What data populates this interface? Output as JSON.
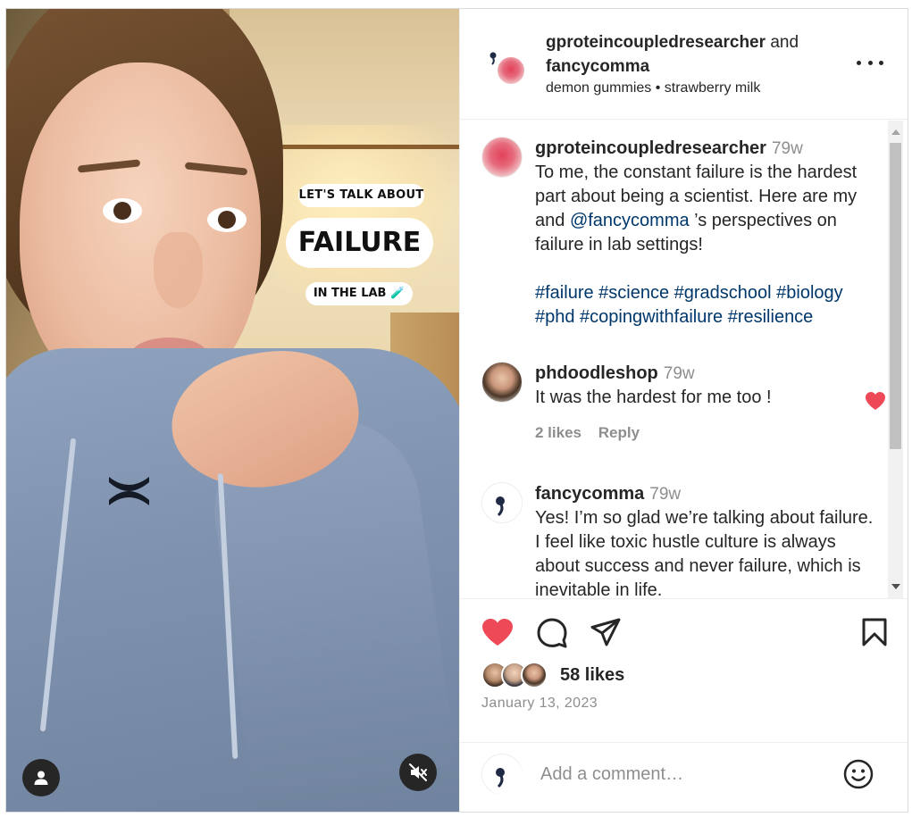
{
  "post": {
    "authors": {
      "primary": "gproteincoupledresearcher",
      "joiner": "and",
      "secondary": "fancycomma"
    },
    "audio": "demon gummies • strawberry milk",
    "overlay": {
      "line1": "LET'S TALK ABOUT",
      "line2": "FAILURE",
      "line3": "IN THE LAB 🧪"
    },
    "caption": {
      "username": "gproteincoupledresearcher",
      "time": "79w",
      "text_before": "To me, the constant failure is the hardest part about being a scientist. Here are my and ",
      "mention": "@fancycomma",
      "text_after": " ’s perspectives on failure in lab settings!",
      "hashtags": "#failure #science #gradschool #biology #phd #copingwithfailure #resilience"
    },
    "comments": [
      {
        "username": "phdoodleshop",
        "time": "79w",
        "text": "It was the hardest for me too !",
        "likes": "2 likes",
        "reply": "Reply",
        "liked": true
      },
      {
        "username": "fancycomma",
        "time": "79w",
        "text": "Yes! I’m so glad we’re talking about failure. I feel like toxic hustle culture is always about success and never failure, which is inevitable in life."
      }
    ],
    "likes_text": "58 likes",
    "date": "January 13, 2023",
    "add_comment_placeholder": "Add a comment…"
  },
  "icons": {
    "like": "heart-filled-icon",
    "comment": "comment-bubble-icon",
    "share": "paper-plane-icon",
    "save": "bookmark-icon",
    "more": "more-horizontal-icon",
    "emoji": "smiley-icon",
    "mute": "speaker-muted-icon",
    "tagged_users": "user-icon"
  },
  "colors": {
    "like_red": "#ed4956",
    "link_blue": "#00376b",
    "muted_text": "#8e8e8e"
  }
}
